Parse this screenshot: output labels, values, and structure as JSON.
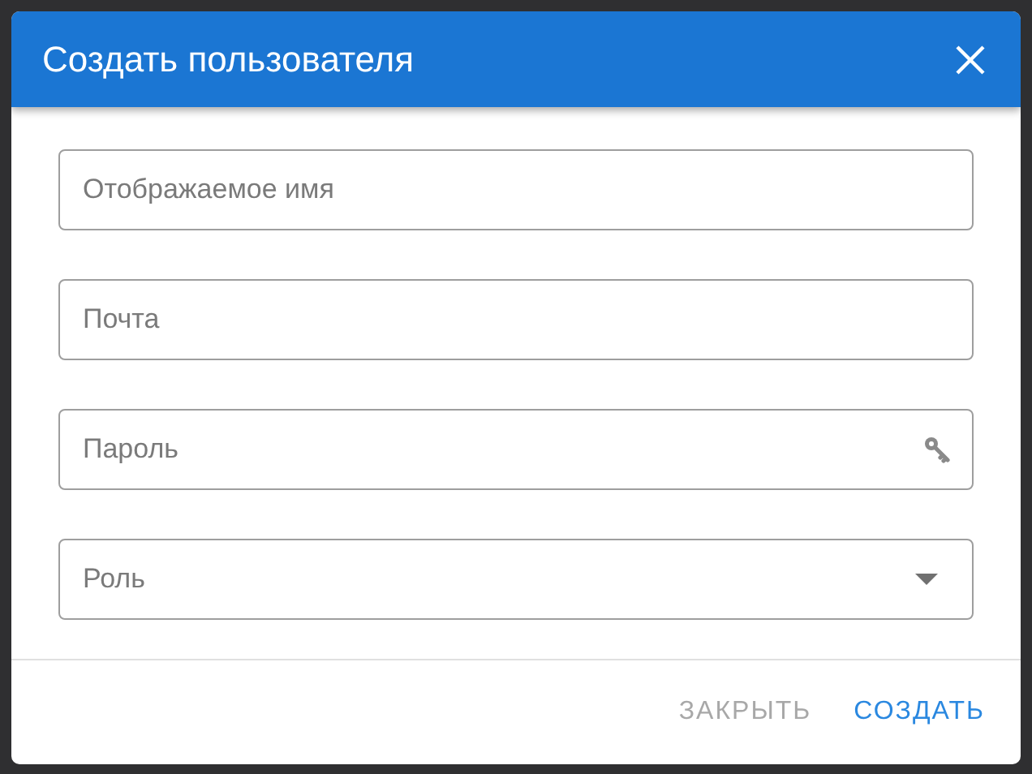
{
  "dialog": {
    "title": "Создать пользователя",
    "fields": [
      {
        "kind": "text",
        "placeholder": "Отображаемое имя"
      },
      {
        "kind": "text",
        "placeholder": "Почта"
      },
      {
        "kind": "password",
        "placeholder": "Пароль"
      },
      {
        "kind": "select",
        "placeholder": "Роль"
      }
    ],
    "buttons": [
      {
        "label": "ЗАКРЫТЬ",
        "disabled": true
      },
      {
        "label": "СОЗДАТЬ",
        "disabled": false
      }
    ]
  }
}
